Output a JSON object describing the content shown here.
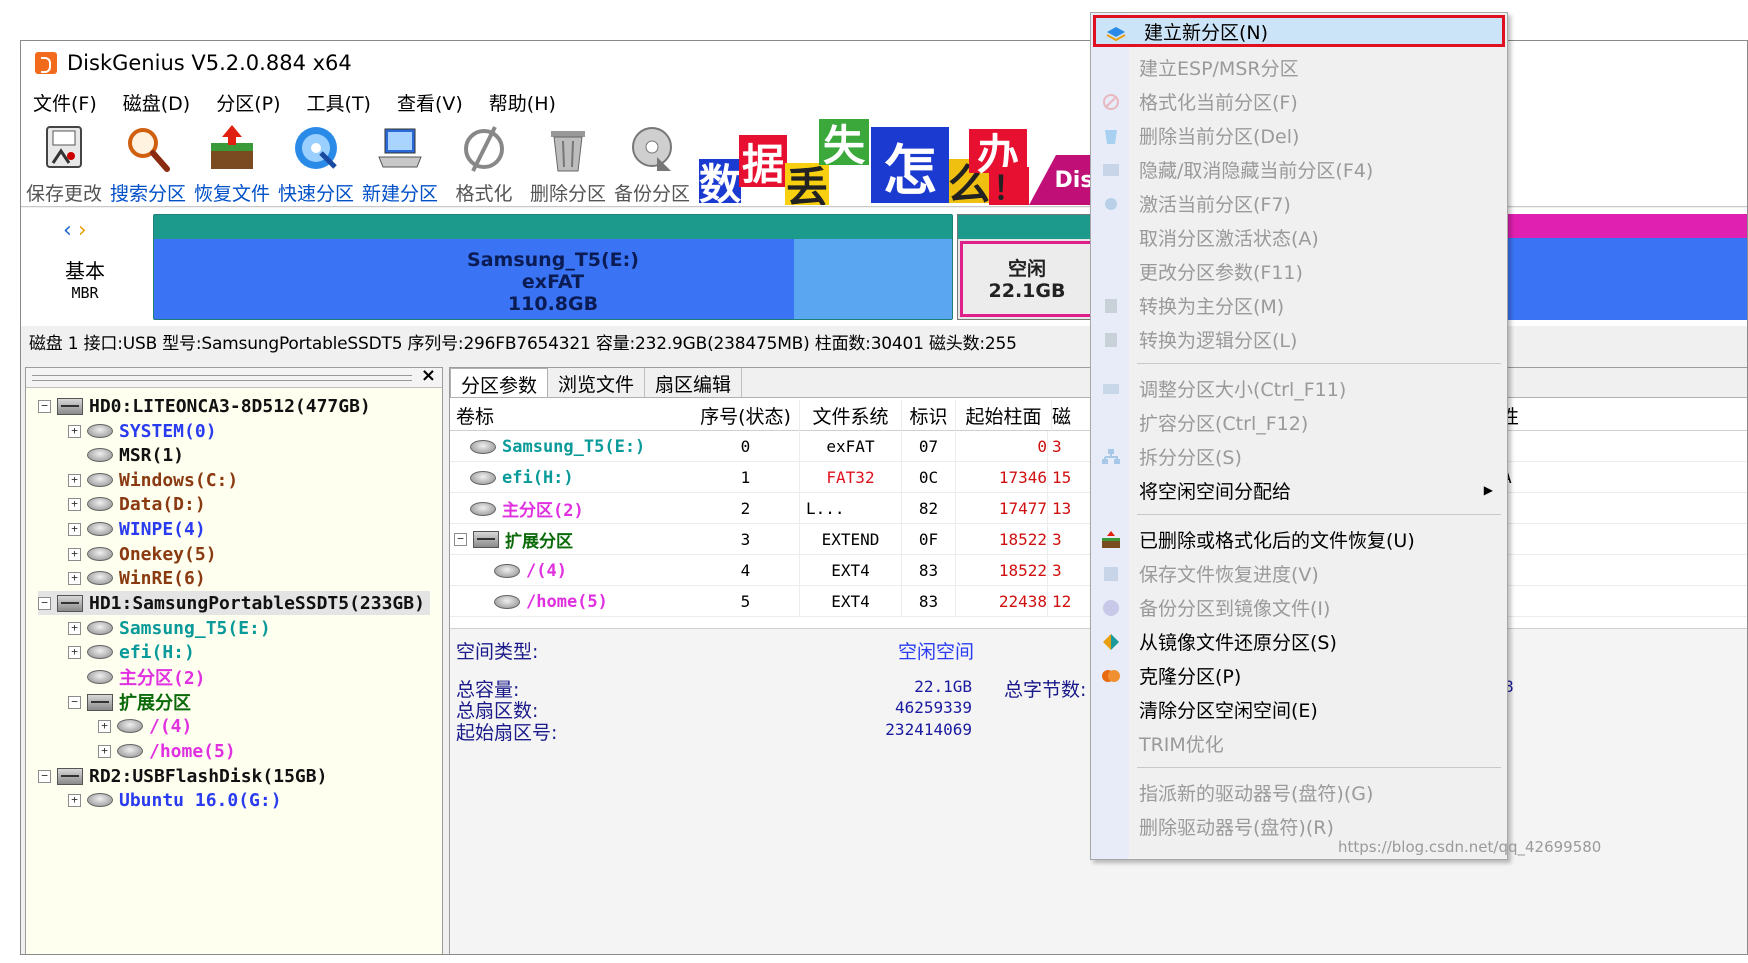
{
  "window": {
    "title": "DiskGenius V5.2.0.884 x64"
  },
  "menubar": [
    "文件(F)",
    "磁盘(D)",
    "分区(P)",
    "工具(T)",
    "查看(V)",
    "帮助(H)"
  ],
  "toolbar": {
    "save": "保存更改",
    "search": "搜索分区",
    "recover": "恢复文件",
    "quick": "快速分区",
    "new": "新建分区",
    "format": "格式化",
    "delete": "删除分区",
    "backup": "备份分区"
  },
  "ad": {
    "t1": "数",
    "t2": "据",
    "t3": "丢",
    "t4": "失",
    "t5": "怎",
    "t6": "么",
    "t7": "办",
    "t8": "！",
    "t9": "Dis"
  },
  "diskmap": {
    "kind_line1": "基本",
    "kind_line2": "MBR",
    "main_name": "Samsung_T5(E:)",
    "main_fs": "exFAT",
    "main_size": "110.8GB",
    "free_name": "空闲",
    "free_size": "22.1GB"
  },
  "diskinfo": "磁盘 1 接口:USB  型号:SamsungPortableSSDT5  序列号:296FB7654321  容量:232.9GB(238475MB)  柱面数:30401  磁头数:255",
  "tree": {
    "close": "×",
    "nodes": [
      {
        "label": "HD0:LITEONCA3-8D512(477GB)"
      },
      {
        "label": "SYSTEM(0)"
      },
      {
        "label": "MSR(1)"
      },
      {
        "label": "Windows(C:)"
      },
      {
        "label": "Data(D:)"
      },
      {
        "label": "WINPE(4)"
      },
      {
        "label": "Onekey(5)"
      },
      {
        "label": "WinRE(6)"
      },
      {
        "label": "HD1:SamsungPortableSSDT5(233GB)"
      },
      {
        "label": "Samsung_T5(E:)"
      },
      {
        "label": "efi(H:)"
      },
      {
        "label": "主分区(2)"
      },
      {
        "label": "扩展分区"
      },
      {
        "label": "/(4)"
      },
      {
        "label": "/home(5)"
      },
      {
        "label": "RD2:USBFlashDisk(15GB)"
      },
      {
        "label": "Ubuntu 16.0(G:)"
      }
    ]
  },
  "tabs": [
    "分区参数",
    "浏览文件",
    "扇区编辑"
  ],
  "partition_table": {
    "headers": [
      "卷标",
      "序号(状态)",
      "文件系统",
      "标识",
      "起始柱面",
      "磁"
    ],
    "rows": [
      {
        "label": "Samsung_T5(E:)",
        "idx": "0",
        "fs": "exFAT",
        "id": "07",
        "start": "0",
        "trunc": "3"
      },
      {
        "label": "efi(H:)",
        "idx": "1",
        "fs": "FAT32",
        "id": "0C",
        "start": "17346",
        "trunc": "15"
      },
      {
        "label": "主分区(2)",
        "idx": "2",
        "fs": "L...",
        "id": "82",
        "start": "17477",
        "trunc": "13"
      },
      {
        "label": "扩展分区",
        "idx": "3",
        "fs": "EXTEND",
        "id": "0F",
        "start": "18522",
        "trunc": "3"
      },
      {
        "label": "/(4)",
        "idx": "4",
        "fs": "EXT4",
        "id": "83",
        "start": "18522",
        "trunc": "3"
      },
      {
        "label": "/home(5)",
        "idx": "5",
        "fs": "EXT4",
        "id": "83",
        "start": "22438",
        "trunc": "12"
      }
    ],
    "extra_header": "性",
    "extra_cell": "A"
  },
  "details": {
    "space_type_label": "空间类型:",
    "space_type_value": "空闲空间",
    "total_label": "总容量:",
    "total_value": "22.1GB",
    "bytes_label": "总字节数:",
    "sectors_label": "总扇区数:",
    "sectors_value": "46259339",
    "start_sector_label": "起始扇区号:",
    "start_sector_value": "232414069",
    "right_digit": "8"
  },
  "context_menu": {
    "items": [
      {
        "label": "建立新分区(N)",
        "state": "selected"
      },
      {
        "label": "建立ESP/MSR分区",
        "state": "disabled"
      },
      {
        "label": "格式化当前分区(F)",
        "state": "disabled"
      },
      {
        "label": "删除当前分区(Del)",
        "state": "disabled"
      },
      {
        "label": "隐藏/取消隐藏当前分区(F4)",
        "state": "disabled"
      },
      {
        "label": "激活当前分区(F7)",
        "state": "disabled"
      },
      {
        "label": "取消分区激活状态(A)",
        "state": "disabled"
      },
      {
        "label": "更改分区参数(F11)",
        "state": "disabled"
      },
      {
        "label": "转换为主分区(M)",
        "state": "disabled"
      },
      {
        "label": "转换为逻辑分区(L)",
        "state": "disabled"
      },
      {
        "label": "调整分区大小(Ctrl_F11)",
        "state": "disabled"
      },
      {
        "label": "扩容分区(Ctrl_F12)",
        "state": "disabled"
      },
      {
        "label": "拆分分区(S)",
        "state": "disabled"
      },
      {
        "label": "将空闲空间分配给",
        "state": "enabled"
      },
      {
        "label": "已删除或格式化后的文件恢复(U)",
        "state": "enabled"
      },
      {
        "label": "保存文件恢复进度(V)",
        "state": "disabled"
      },
      {
        "label": "备份分区到镜像文件(I)",
        "state": "disabled"
      },
      {
        "label": "从镜像文件还原分区(S)",
        "state": "enabled"
      },
      {
        "label": "克隆分区(P)",
        "state": "enabled"
      },
      {
        "label": "清除分区空闲空间(E)",
        "state": "enabled"
      },
      {
        "label": "TRIM优化",
        "state": "disabled"
      },
      {
        "label": "指派新的驱动器号(盘符)(G)",
        "state": "disabled"
      },
      {
        "label": "删除驱动器号(盘符)(R)",
        "state": "disabled"
      }
    ]
  },
  "watermark": "https://blog.csdn.net/qq_42699580",
  "colors": {
    "accent_red": "#e01020",
    "partition_blue": "#3a74f5",
    "partition_teal": "#1c9a8c",
    "free_border": "#e0208a"
  }
}
